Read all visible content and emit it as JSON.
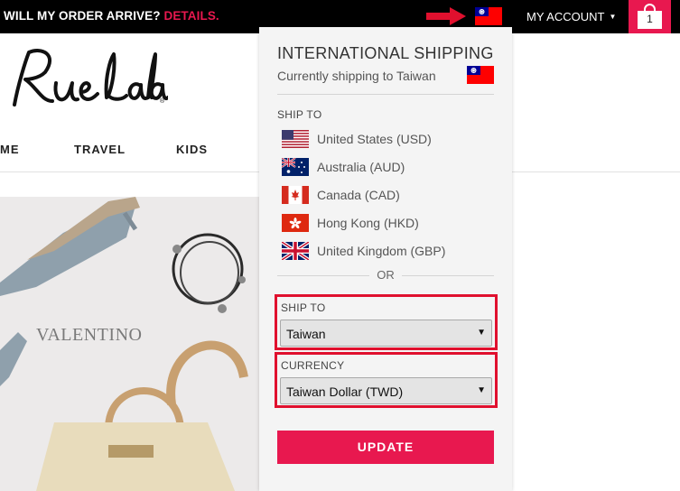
{
  "topbar": {
    "promo_text": "WILL MY ORDER ARRIVE?",
    "promo_link": "DETAILS.",
    "account_label": "MY ACCOUNT",
    "cart_count": "1",
    "current_flag_icon": "taiwan-flag-icon"
  },
  "logo": {
    "alt": "RueLaLa"
  },
  "nav": {
    "items": [
      {
        "label": "ME"
      },
      {
        "label": "TRAVEL"
      },
      {
        "label": "KIDS"
      }
    ]
  },
  "hero": {
    "brand": "VALENTINO"
  },
  "shipping_panel": {
    "title": "INTERNATIONAL SHIPPING",
    "current": "Currently shipping to Taiwan",
    "ship_to_heading": "SHIP TO",
    "countries": [
      {
        "name": "United States (USD)",
        "icon": "us-flag-icon"
      },
      {
        "name": "Australia (AUD)",
        "icon": "australia-flag-icon"
      },
      {
        "name": "Canada (CAD)",
        "icon": "canada-flag-icon"
      },
      {
        "name": "Hong Kong (HKD)",
        "icon": "hong-kong-flag-icon"
      },
      {
        "name": "United Kingdom (GBP)",
        "icon": "uk-flag-icon"
      }
    ],
    "or_label": "OR",
    "ship_to_select": {
      "label": "SHIP TO",
      "value": "Taiwan"
    },
    "currency_select": {
      "label": "CURRENCY",
      "value": "Taiwan Dollar (TWD)"
    },
    "update_label": "UPDATE"
  },
  "colors": {
    "accent": "#e8184f",
    "highlight_box": "#e0102e",
    "panel_bg": "#f4f4f4"
  }
}
